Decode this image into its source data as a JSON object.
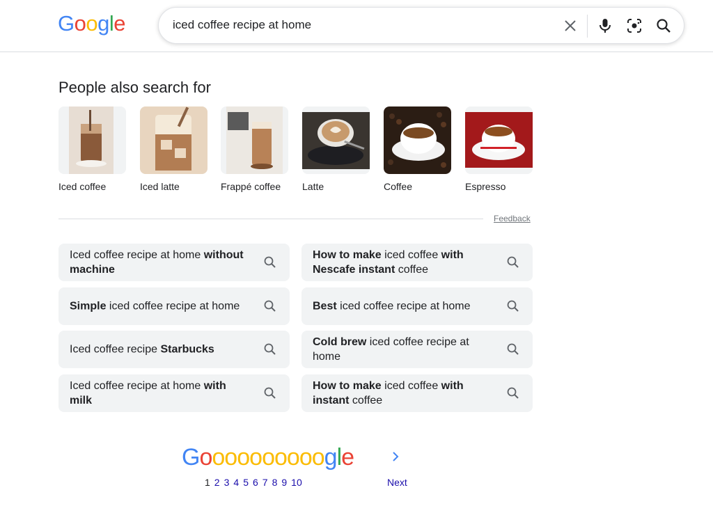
{
  "header": {
    "logo": [
      "G",
      "o",
      "o",
      "g",
      "l",
      "e"
    ],
    "logo_colors": [
      "#4285f4",
      "#ea4335",
      "#fbbc05",
      "#4285f4",
      "#34a853",
      "#ea4335"
    ],
    "search_query": "iced coffee recipe at home",
    "icons": [
      "clear-icon",
      "microphone-icon",
      "lens-icon",
      "search-icon"
    ]
  },
  "pasf": {
    "title": "People also search for",
    "items": [
      {
        "label": "Iced coffee"
      },
      {
        "label": "Iced latte"
      },
      {
        "label": "Frappé coffee"
      },
      {
        "label": "Latte"
      },
      {
        "label": "Coffee"
      },
      {
        "label": "Espresso"
      }
    ],
    "feedback": "Feedback"
  },
  "related": [
    {
      "parts": [
        {
          "t": "Iced coffee recipe at home ",
          "b": false
        },
        {
          "t": "without machine",
          "b": true
        }
      ]
    },
    {
      "parts": [
        {
          "t": "How to make",
          "b": true
        },
        {
          "t": " iced coffee ",
          "b": false
        },
        {
          "t": "with",
          "b": true
        },
        {
          "t": " ",
          "b": false
        },
        {
          "t": "Nescafe instant",
          "b": true
        },
        {
          "t": " coffee",
          "b": false
        }
      ]
    },
    {
      "parts": [
        {
          "t": "Simple",
          "b": true
        },
        {
          "t": " iced coffee recipe at home",
          "b": false
        }
      ]
    },
    {
      "parts": [
        {
          "t": "Best",
          "b": true
        },
        {
          "t": " iced coffee recipe at home",
          "b": false
        }
      ]
    },
    {
      "parts": [
        {
          "t": "Iced coffee recipe ",
          "b": false
        },
        {
          "t": "Starbucks",
          "b": true
        }
      ]
    },
    {
      "parts": [
        {
          "t": "Cold brew",
          "b": true
        },
        {
          "t": " iced coffee recipe at home",
          "b": false
        }
      ]
    },
    {
      "parts": [
        {
          "t": "Iced coffee recipe at home ",
          "b": false
        },
        {
          "t": "with milk",
          "b": true
        }
      ]
    },
    {
      "parts": [
        {
          "t": "How to make",
          "b": true
        },
        {
          "t": " iced coffee ",
          "b": false
        },
        {
          "t": "with instant",
          "b": true
        },
        {
          "t": " coffee",
          "b": false
        }
      ]
    }
  ],
  "pager": {
    "logo_letters": [
      "G",
      "o",
      "o",
      "o",
      "o",
      "o",
      "o",
      "o",
      "o",
      "o",
      "o",
      "g",
      "l",
      "e"
    ],
    "logo_colors": [
      "#4285f4",
      "#ea4335",
      "#fbbc05",
      "#fbbc05",
      "#fbbc05",
      "#fbbc05",
      "#fbbc05",
      "#fbbc05",
      "#fbbc05",
      "#fbbc05",
      "#fbbc05",
      "#4285f4",
      "#34a853",
      "#ea4335"
    ],
    "pages": [
      "1",
      "2",
      "3",
      "4",
      "5",
      "6",
      "7",
      "8",
      "9",
      "10"
    ],
    "current": "1",
    "next": "Next"
  },
  "colors": {
    "link": "#1a0dab",
    "chip_bg": "#f1f3f4",
    "icon_gray": "#5f6368"
  }
}
